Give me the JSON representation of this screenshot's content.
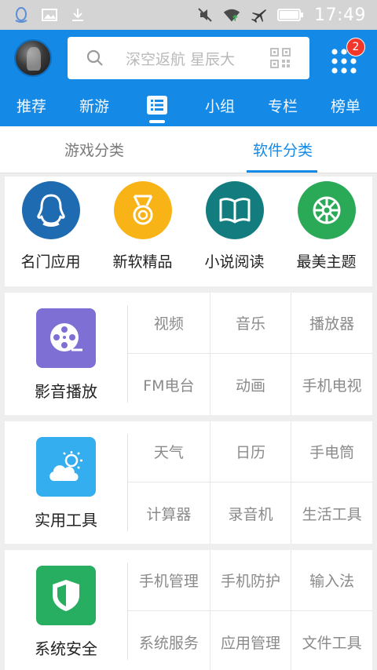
{
  "status_bar": {
    "time": "17:49",
    "left_icons": [
      "qq-icon",
      "image-icon",
      "download-icon"
    ],
    "right_icons": [
      "mute-icon",
      "wifi-icon",
      "airplane-icon",
      "battery-icon"
    ]
  },
  "header": {
    "search_placeholder": "深空返航 星辰大",
    "badge_count": "2",
    "nav_tabs": [
      {
        "label": "推荐"
      },
      {
        "label": "新游"
      },
      {
        "label": ""
      },
      {
        "label": "小组"
      },
      {
        "label": "专栏"
      },
      {
        "label": "榜单"
      }
    ]
  },
  "sub_tabs": [
    {
      "label": "游戏分类",
      "active": false
    },
    {
      "label": "软件分类",
      "active": true
    }
  ],
  "top_categories": [
    {
      "label": "名门应用",
      "icon": "qq-penguin-icon",
      "color": "#1e6bb2"
    },
    {
      "label": "新软精品",
      "icon": "medal-icon",
      "color": "#f8b417"
    },
    {
      "label": "小说阅读",
      "icon": "book-icon",
      "color": "#137c7f"
    },
    {
      "label": "最美主题",
      "icon": "theme-wheel-icon",
      "color": "#2aaa57"
    }
  ],
  "groups": [
    {
      "title": "影音播放",
      "icon": "film-reel-icon",
      "color": "#7d6fd3",
      "items": [
        "视频",
        "音乐",
        "播放器",
        "FM电台",
        "动画",
        "手机电视"
      ]
    },
    {
      "title": "实用工具",
      "icon": "weather-icon",
      "color": "#35aef0",
      "items": [
        "天气",
        "日历",
        "手电筒",
        "计算器",
        "录音机",
        "生活工具"
      ]
    },
    {
      "title": "系统安全",
      "icon": "shield-icon",
      "color": "#27ae60",
      "items": [
        "手机管理",
        "手机防护",
        "输入法",
        "系统服务",
        "应用管理",
        "文件工具"
      ]
    }
  ]
}
